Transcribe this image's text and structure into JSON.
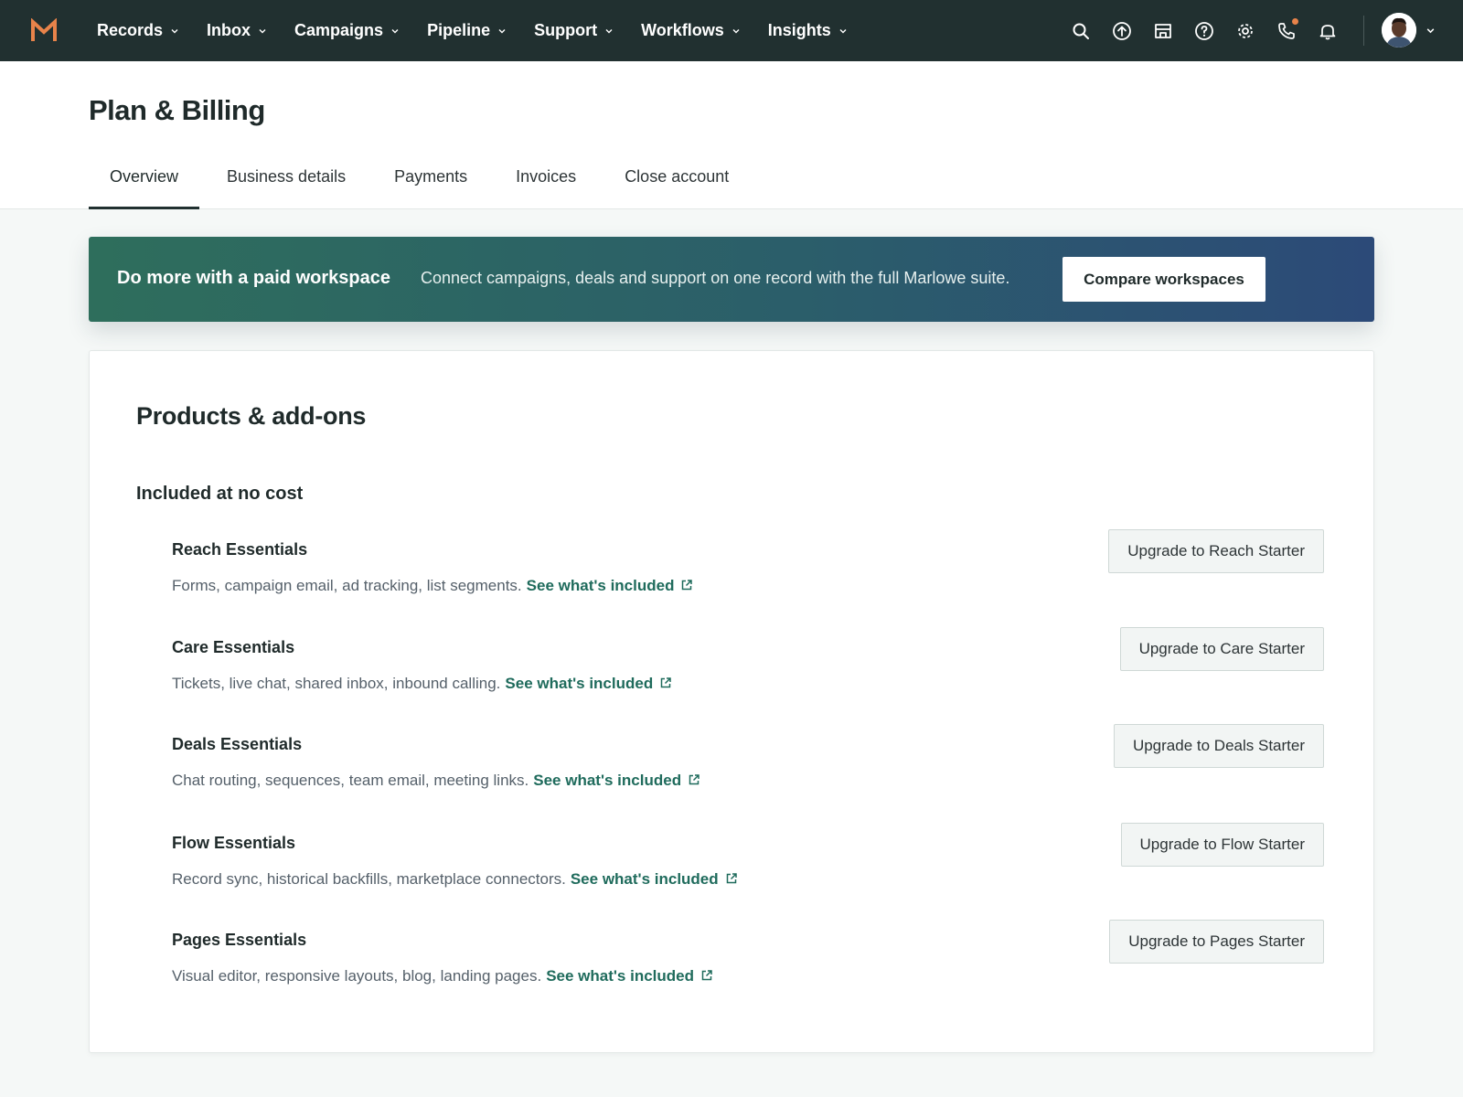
{
  "nav": {
    "items": [
      {
        "label": "Records"
      },
      {
        "label": "Inbox"
      },
      {
        "label": "Campaigns"
      },
      {
        "label": "Pipeline"
      },
      {
        "label": "Support"
      },
      {
        "label": "Workflows"
      },
      {
        "label": "Insights"
      }
    ],
    "icons": [
      "search-icon",
      "upload-icon",
      "marketplace-icon",
      "help-icon",
      "settings-icon",
      "phone-icon",
      "bell-icon"
    ],
    "logo_color": "#e8834a",
    "notification_dot_color": "#e8834a"
  },
  "page": {
    "title": "Plan & Billing",
    "tabs": [
      {
        "label": "Overview",
        "active": true
      },
      {
        "label": "Business details"
      },
      {
        "label": "Payments"
      },
      {
        "label": "Invoices"
      },
      {
        "label": "Close account"
      }
    ]
  },
  "banner": {
    "title": "Do more with a paid workspace",
    "text": "Connect campaigns, deals and support on one record with the full Marlowe suite.",
    "button_label": "Compare workspaces"
  },
  "products": {
    "title": "Products & add-ons",
    "section_title": "Included at no cost",
    "items": [
      {
        "name": "Reach Essentials",
        "desc": "Forms, campaign email, ad tracking, list segments.",
        "link": "See what's included",
        "button": "Upgrade to Reach Starter"
      },
      {
        "name": "Care Essentials",
        "desc": "Tickets, live chat, shared inbox, inbound calling.",
        "link": "See what's included",
        "button": "Upgrade to Care Starter"
      },
      {
        "name": "Deals Essentials",
        "desc": "Chat routing, sequences, team email, meeting links.",
        "link": "See what's included",
        "button": "Upgrade to Deals Starter"
      },
      {
        "name": "Flow Essentials",
        "desc": "Record sync, historical backfills, marketplace connectors.",
        "link": "See what's included",
        "button": "Upgrade to Flow Starter"
      },
      {
        "name": "Pages Essentials",
        "desc": "Visual editor, responsive layouts, blog, landing pages.",
        "link": "See what's included",
        "button": "Upgrade to Pages Starter"
      }
    ]
  }
}
